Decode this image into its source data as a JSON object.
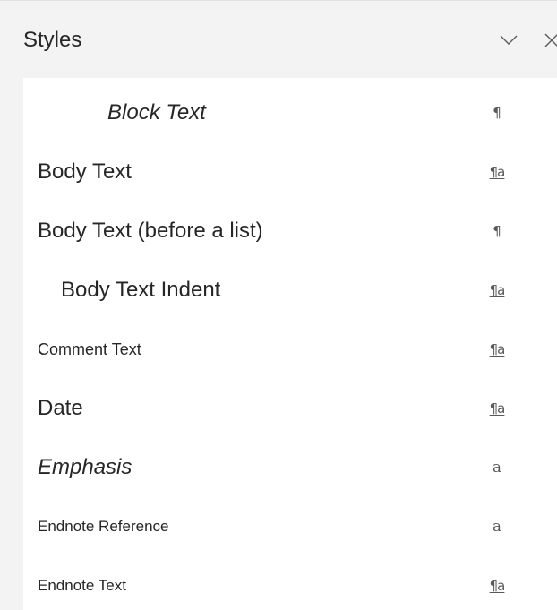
{
  "pane": {
    "title": "Styles",
    "collapse_label": "collapse-pane",
    "close_label": "close-pane"
  },
  "icons": {
    "chevron": "chevron-down-icon",
    "close": "close-icon",
    "paragraph": "paragraph-style-icon",
    "linked": "linked-style-icon",
    "character": "character-style-icon"
  },
  "styles": [
    {
      "name": "Block Text",
      "type_glyph": "¶"
    },
    {
      "name": "Body Text",
      "type_glyph": "¶a"
    },
    {
      "name": "Body Text (before a list)",
      "type_glyph": "¶"
    },
    {
      "name": "Body Text Indent",
      "type_glyph": "¶a"
    },
    {
      "name": "Comment Text",
      "type_glyph": "¶a"
    },
    {
      "name": "Date",
      "type_glyph": "¶a"
    },
    {
      "name": "Emphasis",
      "type_glyph": "a"
    },
    {
      "name": "Endnote Reference",
      "type_glyph": "a"
    },
    {
      "name": "Endnote Text",
      "type_glyph": "¶a"
    }
  ],
  "colors": {
    "pane_background": "#f3f3f3",
    "list_background": "#ffffff",
    "text": "#262626",
    "type_glyph": "#5a5a5a"
  }
}
